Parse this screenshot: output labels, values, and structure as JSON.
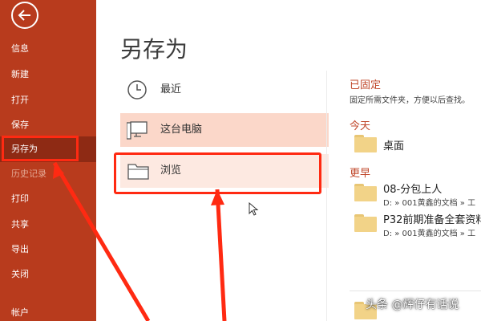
{
  "sidebar": {
    "items": [
      {
        "label": "信息"
      },
      {
        "label": "新建"
      },
      {
        "label": "打开"
      },
      {
        "label": "保存"
      },
      {
        "label": "另存为",
        "state": "selected"
      },
      {
        "label": "历史记录",
        "state": "disabled"
      },
      {
        "label": "打印"
      },
      {
        "label": "共享"
      },
      {
        "label": "导出"
      },
      {
        "label": "关闭"
      },
      {
        "label": "帐户"
      }
    ]
  },
  "main": {
    "title": "另存为",
    "locations": [
      {
        "label": "最近",
        "icon": "clock-icon"
      },
      {
        "label": "这台电脑",
        "icon": "computer-icon"
      },
      {
        "label": "浏览",
        "icon": "folder-icon"
      }
    ]
  },
  "right": {
    "pinned": {
      "title": "已固定",
      "description": "固定所需文件夹，方便以后查找。"
    },
    "today": {
      "title": "今天",
      "folders": [
        {
          "name": "桌面"
        }
      ]
    },
    "earlier": {
      "title": "更早",
      "folders": [
        {
          "name": "08-分包上人",
          "path": "D: » 001黄鑫的文档 » 工"
        },
        {
          "name": "P32前期准备全套资料",
          "path": "D: » 001黄鑫的文档 » 工"
        }
      ]
    }
  },
  "watermark": "头条 @辉仔有话说",
  "colors": {
    "sidebar": "#b83b1d",
    "sidebar_selected": "#8e2a14",
    "highlight_box": "#ff2a12",
    "pinned_title": "#c0472a",
    "folder": "#f2d388"
  }
}
